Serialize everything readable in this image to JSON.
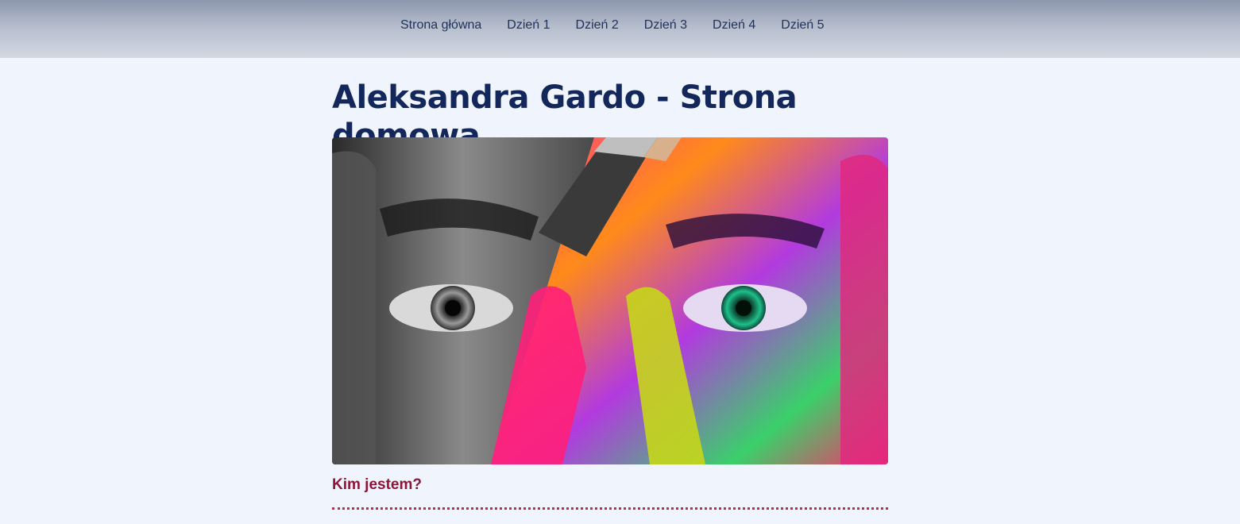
{
  "nav": {
    "items": [
      {
        "label": "Strona główna"
      },
      {
        "label": "Dzień 1"
      },
      {
        "label": "Dzień 2"
      },
      {
        "label": "Dzień 3"
      },
      {
        "label": "Dzień 4"
      },
      {
        "label": "Dzień 5"
      }
    ]
  },
  "page": {
    "title": "Aleksandra Gardo - Strona domowa",
    "hero_image": "painted-face-photo",
    "section_heading": "Kim jestem?"
  },
  "colors": {
    "nav_text": "#1f3259",
    "title": "#14275a",
    "section_heading": "#8c1638",
    "divider": "#d0214f",
    "background": "#f0f4fd"
  }
}
